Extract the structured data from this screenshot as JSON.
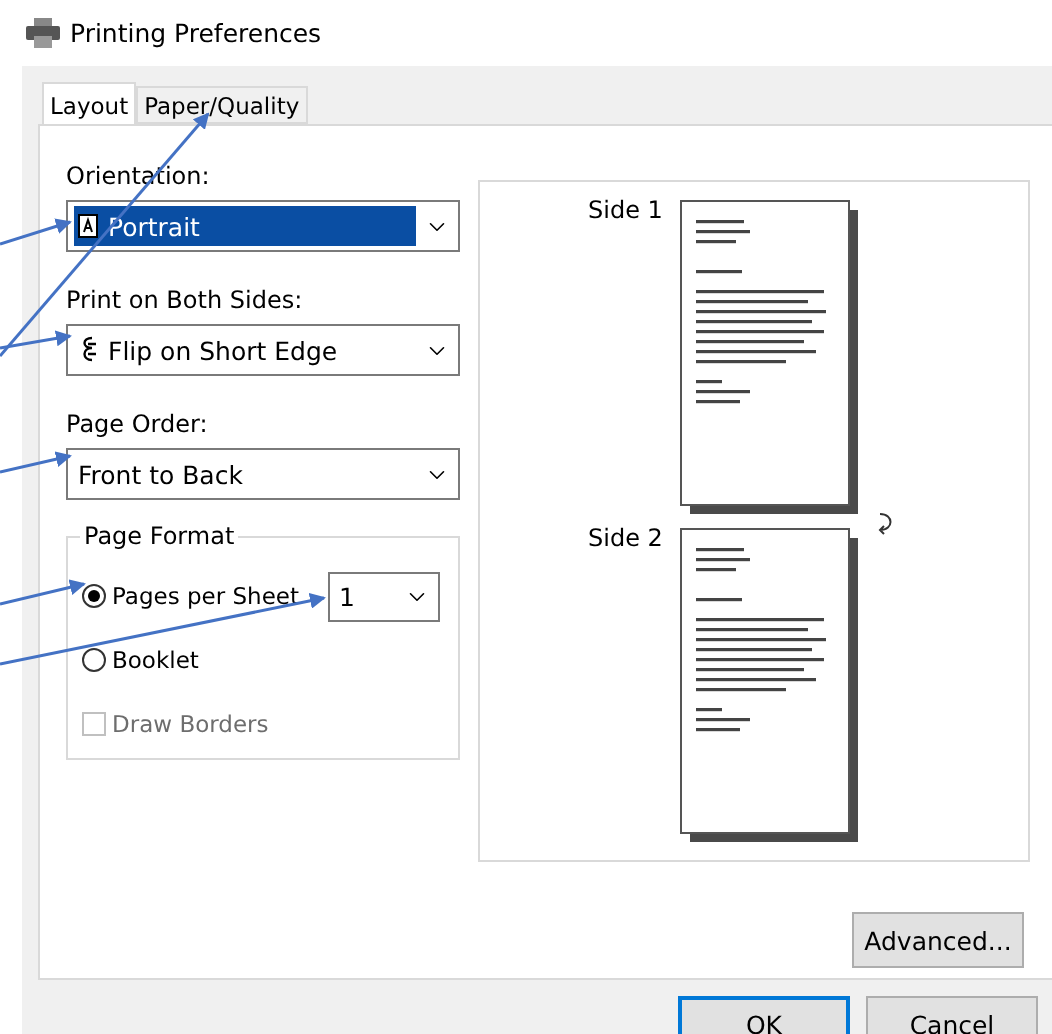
{
  "window": {
    "title": "Printing Preferences"
  },
  "tabs": [
    {
      "label": "Layout",
      "selected": true
    },
    {
      "label": "Paper/Quality",
      "selected": false
    }
  ],
  "orientation": {
    "label": "Orientation:",
    "value": "Portrait",
    "highlighted": true
  },
  "print_on_both_sides": {
    "label": "Print on Both Sides:",
    "value": "Flip on Short Edge",
    "highlighted": false
  },
  "page_order": {
    "label": "Page Order:",
    "value": "Front to Back",
    "highlighted": false
  },
  "page_format": {
    "title": "Page Format",
    "options": [
      {
        "label": "Pages per Sheet",
        "selected": true
      },
      {
        "label": "Booklet",
        "selected": false
      }
    ],
    "pages_per_sheet": "1",
    "draw_borders": {
      "label": "Draw Borders",
      "checked": false,
      "disabled": true
    }
  },
  "preview": {
    "sides": [
      "Side 1",
      "Side 2"
    ]
  },
  "buttons": {
    "advanced": "Advanced...",
    "ok": "OK",
    "cancel": "Cancel"
  }
}
